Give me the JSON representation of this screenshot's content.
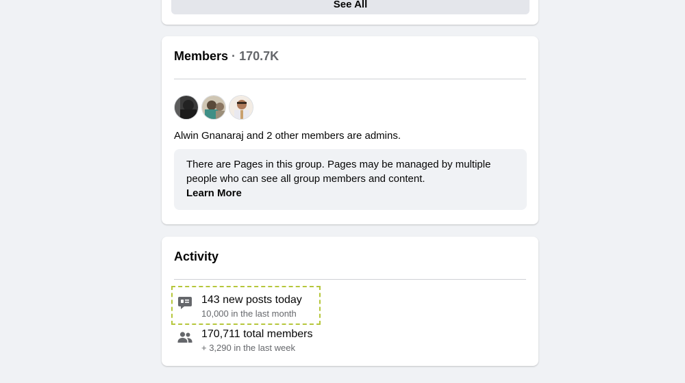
{
  "top_card": {
    "see_all_label": "See All"
  },
  "members": {
    "title": "Members",
    "separator": "·",
    "count": "170.7K",
    "admins_text": "Alwin Gnanaraj and 2 other members are admins.",
    "pages_notice": "There are Pages in this group. Pages may be managed by multiple people who can see all group members and content.",
    "learn_more": "Learn More"
  },
  "activity": {
    "title": "Activity",
    "stats": [
      {
        "icon": "chat-bubble-icon",
        "main": "143 new posts today",
        "sub": "10,000 in the last month"
      },
      {
        "icon": "people-icon",
        "main": "170,711 total members",
        "sub": "+ 3,290 in the last week"
      }
    ]
  },
  "colors": {
    "background": "#f0f2f5",
    "card": "#ffffff",
    "secondary_text": "#65676b",
    "button_bg": "#e4e6eb",
    "highlight_border": "#b5c63a",
    "icon": "#65676b"
  }
}
